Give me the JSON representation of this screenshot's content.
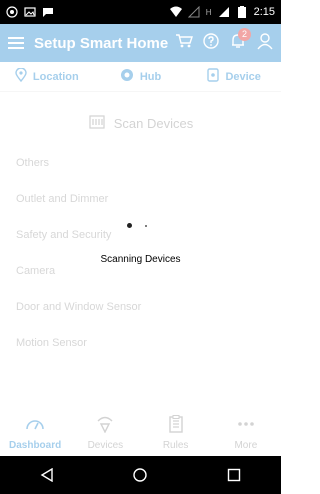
{
  "status_bar": {
    "time": "2:15",
    "left_icons": [
      "whatsapp-icon",
      "gallery-icon",
      "message-icon"
    ],
    "right_icons": [
      "wifi-icon",
      "no-signal-icon",
      "h-signal-icon",
      "signal-icon",
      "battery-icon"
    ],
    "h_label": "H"
  },
  "app_bar": {
    "title": "Setup Smart Home",
    "notification_count": "2",
    "icons": [
      "cart-icon",
      "help-icon",
      "bell-icon",
      "account-icon"
    ]
  },
  "tabs": [
    {
      "label": "Location",
      "icon": "location-pin-icon"
    },
    {
      "label": "Hub",
      "icon": "hub-icon"
    },
    {
      "label": "Device",
      "icon": "device-icon"
    }
  ],
  "scan": {
    "label": "Scan Devices"
  },
  "device_categories": [
    {
      "label": "Others"
    },
    {
      "label": "Outlet and Dimmer"
    },
    {
      "label": "Safety and Security"
    },
    {
      "label": "Camera"
    },
    {
      "label": "Door and Window Sensor"
    },
    {
      "label": "Motion Sensor"
    }
  ],
  "loading": {
    "text": "Scanning Devices"
  },
  "bottom_nav": [
    {
      "label": "Dashboard",
      "icon": "dashboard-icon",
      "active": true
    },
    {
      "label": "Devices",
      "icon": "devices-icon",
      "active": false
    },
    {
      "label": "Rules",
      "icon": "rules-icon",
      "active": false
    },
    {
      "label": "More",
      "icon": "more-icon",
      "active": false
    }
  ],
  "colors": {
    "primary": "#3b95d5",
    "status_bar": "#000000",
    "badge": "#e23b3b",
    "muted_text": "#a7a7a7"
  }
}
